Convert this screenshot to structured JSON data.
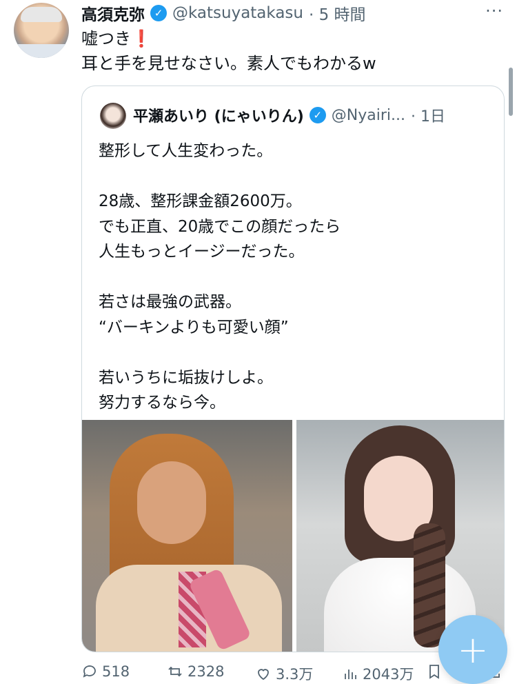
{
  "tweet": {
    "author_name": "高須克弥",
    "handle": "@katsuyatakasu",
    "time": "· 5 時間",
    "text_line1": "嘘つき",
    "alarm": "❗",
    "text_line2": "耳と手を見せなさい。素人でもわかるw",
    "verified_mark": "✓",
    "more": "···"
  },
  "quote": {
    "author_name": "平瀬あいり (にゃいりん)",
    "handle": "@Nyairi...",
    "time": "· 1日",
    "verified_mark": "✓",
    "text": "整形して人生変わった。\n\n28歳、整形課金額2600万。\nでも正直、20歳でこの顔だったら\n人生もっとイージーだった。\n\n若さは最強の武器。\n“バーキンよりも可愛い顔”\n\n若いうちに垢抜けしよ。\n努力するなら今。"
  },
  "actions": {
    "replies": "518",
    "retweets": "2328",
    "likes": "3.3万",
    "views": "2043万"
  },
  "fab_label": "+",
  "colors": {
    "verified": "#1d9bf0",
    "text": "#0f1419",
    "secondary": "#536471",
    "fab": "#8fcaf3"
  },
  "icons": [
    "verified-icon",
    "more-icon",
    "reply-icon",
    "retweet-icon",
    "like-icon",
    "views-icon",
    "bookmark-icon",
    "share-icon",
    "compose-icon"
  ]
}
